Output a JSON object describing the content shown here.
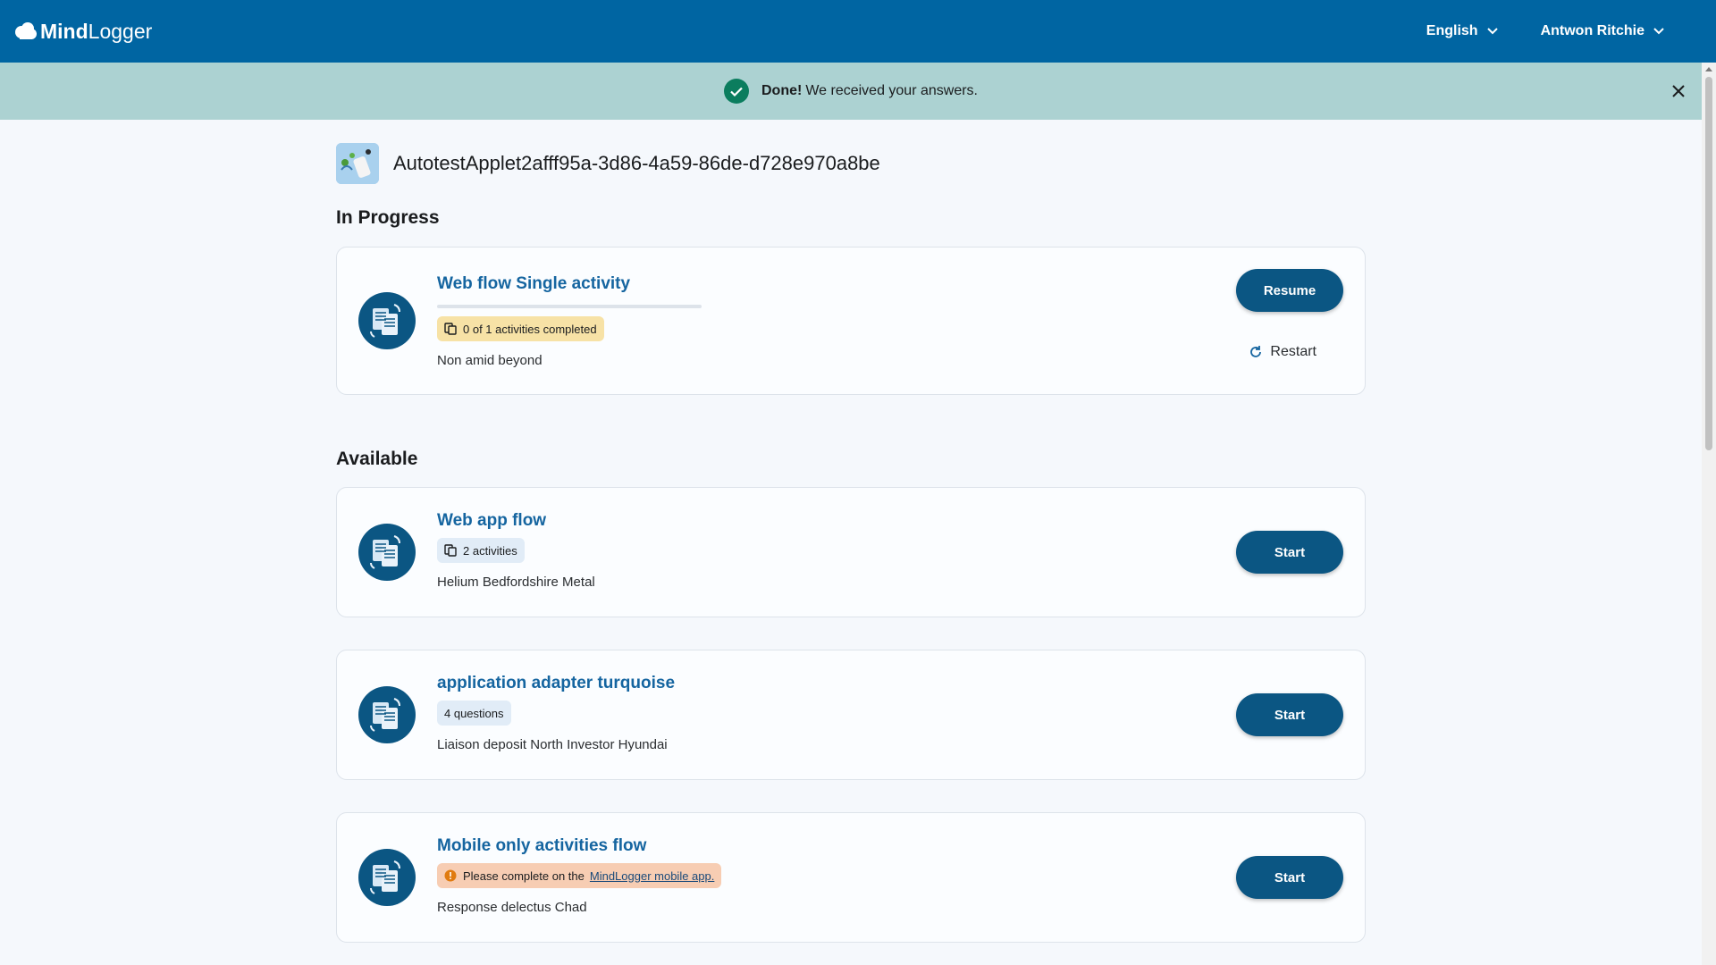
{
  "header": {
    "logo_bold": "Mind",
    "logo_light": "Logger",
    "language": "English",
    "user": "Antwon Ritchie"
  },
  "banner": {
    "strong": "Done!",
    "text": "We received your answers."
  },
  "applet": {
    "title": "AutotestApplet2afff95a-3d86-4a59-86de-d728e970a8be"
  },
  "in_progress": {
    "heading": "In Progress",
    "items": [
      {
        "name": "Web flow Single activity",
        "progress": 0,
        "chip": "0 of 1 activities completed",
        "description": "Non amid beyond",
        "button": "Resume",
        "restart": "Restart"
      }
    ]
  },
  "available": {
    "heading": "Available",
    "items": [
      {
        "name": "Web app flow",
        "chip": "2 activities",
        "description": "Helium Bedfordshire Metal",
        "button": "Start"
      },
      {
        "name": "application adapter turquoise",
        "chip": "4 questions",
        "description": "Liaison deposit North Investor Hyundai",
        "button": "Start"
      },
      {
        "name": "Mobile only activities flow",
        "chip": "Please complete on the",
        "chip_link": "MindLogger mobile app.",
        "description": "Response delectus Chad",
        "button": "Start"
      }
    ]
  },
  "colors": {
    "header_bg": "#0065a2",
    "banner_bg": "#acd2d2",
    "primary_button": "#0b5683",
    "link": "#1565a0",
    "success": "#0b7d5e",
    "warning": "#e07b10"
  }
}
